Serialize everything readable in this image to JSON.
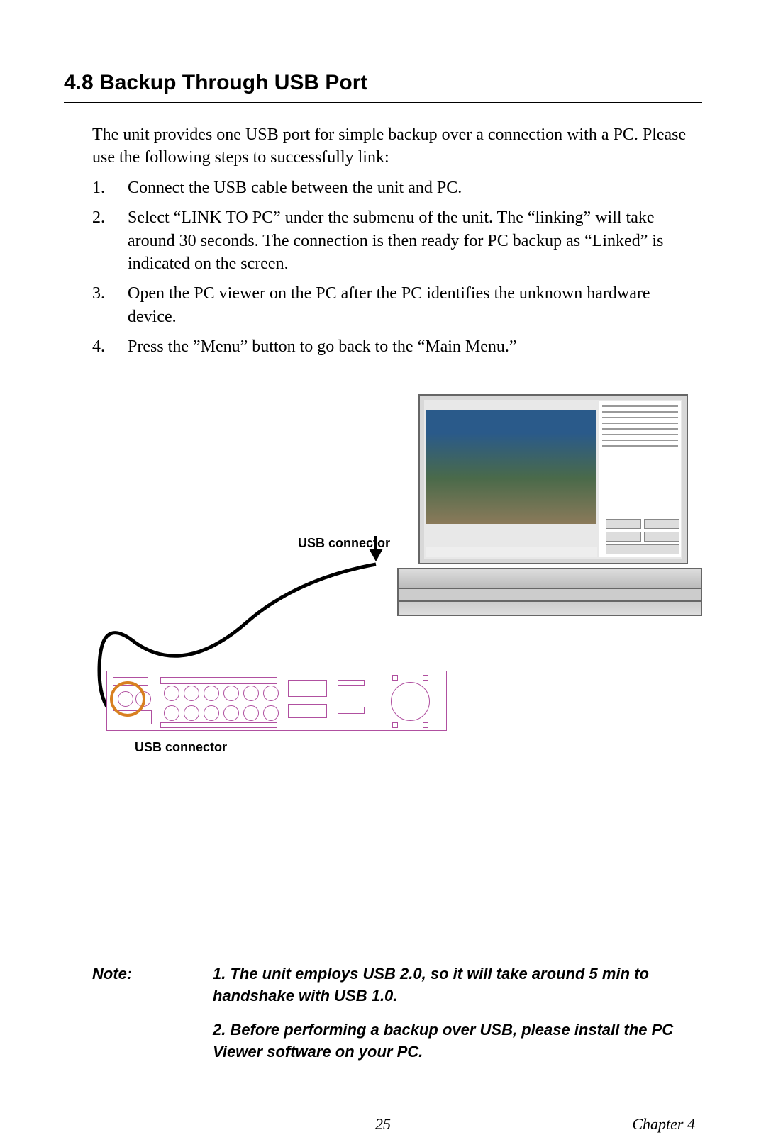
{
  "heading": "4.8  Backup Through USB Port",
  "intro": "The unit provides one USB port for simple backup over a connection with a PC. Please use the following steps to successfully link:",
  "steps": [
    {
      "num": "1.",
      "text": "Connect the USB cable between the unit and PC."
    },
    {
      "num": "2.",
      "text": "Select “LINK TO PC” under the submenu of the unit. The “linking” will take around 30 seconds. The connection is then ready for PC backup as “Linked” is indicated on the screen."
    },
    {
      "num": "3.",
      "text": "Open the PC viewer on the PC after the PC identifies the unknown hardware device."
    },
    {
      "num": "4.",
      "text": "Press the ”Menu” button to go back to the “Main Menu.”"
    }
  ],
  "diagram": {
    "usb_label_top": "USB connector",
    "usb_label_bottom": "USB connector"
  },
  "note": {
    "label": "Note:",
    "items": [
      "1. The unit employs USB 2.0, so it will take around 5 min to handshake with USB 1.0.",
      "2. Before performing a backup over USB, please install the PC Viewer software on your PC."
    ]
  },
  "footer": {
    "page": "25",
    "chapter": "Chapter 4"
  }
}
